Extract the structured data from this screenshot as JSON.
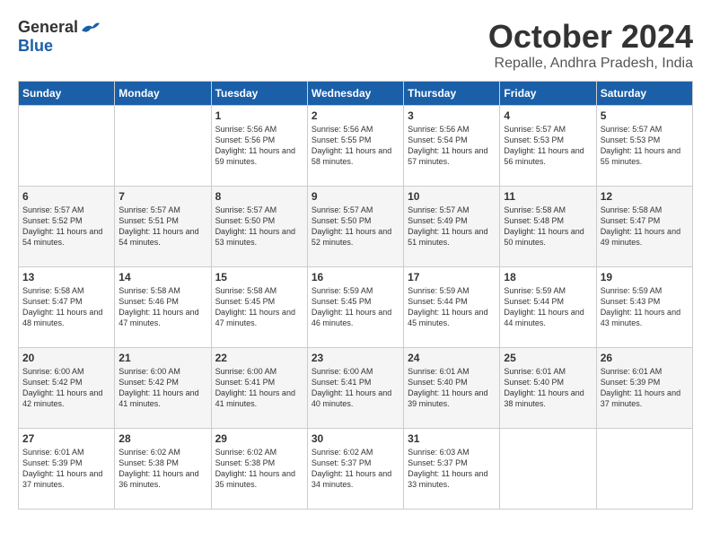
{
  "logo": {
    "general": "General",
    "blue": "Blue"
  },
  "title": "October 2024",
  "subtitle": "Repalle, Andhra Pradesh, India",
  "weekdays": [
    "Sunday",
    "Monday",
    "Tuesday",
    "Wednesday",
    "Thursday",
    "Friday",
    "Saturday"
  ],
  "weeks": [
    [
      {
        "day": "",
        "info": ""
      },
      {
        "day": "",
        "info": ""
      },
      {
        "day": "1",
        "info": "Sunrise: 5:56 AM\nSunset: 5:56 PM\nDaylight: 11 hours and 59 minutes."
      },
      {
        "day": "2",
        "info": "Sunrise: 5:56 AM\nSunset: 5:55 PM\nDaylight: 11 hours and 58 minutes."
      },
      {
        "day": "3",
        "info": "Sunrise: 5:56 AM\nSunset: 5:54 PM\nDaylight: 11 hours and 57 minutes."
      },
      {
        "day": "4",
        "info": "Sunrise: 5:57 AM\nSunset: 5:53 PM\nDaylight: 11 hours and 56 minutes."
      },
      {
        "day": "5",
        "info": "Sunrise: 5:57 AM\nSunset: 5:53 PM\nDaylight: 11 hours and 55 minutes."
      }
    ],
    [
      {
        "day": "6",
        "info": "Sunrise: 5:57 AM\nSunset: 5:52 PM\nDaylight: 11 hours and 54 minutes."
      },
      {
        "day": "7",
        "info": "Sunrise: 5:57 AM\nSunset: 5:51 PM\nDaylight: 11 hours and 54 minutes."
      },
      {
        "day": "8",
        "info": "Sunrise: 5:57 AM\nSunset: 5:50 PM\nDaylight: 11 hours and 53 minutes."
      },
      {
        "day": "9",
        "info": "Sunrise: 5:57 AM\nSunset: 5:50 PM\nDaylight: 11 hours and 52 minutes."
      },
      {
        "day": "10",
        "info": "Sunrise: 5:57 AM\nSunset: 5:49 PM\nDaylight: 11 hours and 51 minutes."
      },
      {
        "day": "11",
        "info": "Sunrise: 5:58 AM\nSunset: 5:48 PM\nDaylight: 11 hours and 50 minutes."
      },
      {
        "day": "12",
        "info": "Sunrise: 5:58 AM\nSunset: 5:47 PM\nDaylight: 11 hours and 49 minutes."
      }
    ],
    [
      {
        "day": "13",
        "info": "Sunrise: 5:58 AM\nSunset: 5:47 PM\nDaylight: 11 hours and 48 minutes."
      },
      {
        "day": "14",
        "info": "Sunrise: 5:58 AM\nSunset: 5:46 PM\nDaylight: 11 hours and 47 minutes."
      },
      {
        "day": "15",
        "info": "Sunrise: 5:58 AM\nSunset: 5:45 PM\nDaylight: 11 hours and 47 minutes."
      },
      {
        "day": "16",
        "info": "Sunrise: 5:59 AM\nSunset: 5:45 PM\nDaylight: 11 hours and 46 minutes."
      },
      {
        "day": "17",
        "info": "Sunrise: 5:59 AM\nSunset: 5:44 PM\nDaylight: 11 hours and 45 minutes."
      },
      {
        "day": "18",
        "info": "Sunrise: 5:59 AM\nSunset: 5:44 PM\nDaylight: 11 hours and 44 minutes."
      },
      {
        "day": "19",
        "info": "Sunrise: 5:59 AM\nSunset: 5:43 PM\nDaylight: 11 hours and 43 minutes."
      }
    ],
    [
      {
        "day": "20",
        "info": "Sunrise: 6:00 AM\nSunset: 5:42 PM\nDaylight: 11 hours and 42 minutes."
      },
      {
        "day": "21",
        "info": "Sunrise: 6:00 AM\nSunset: 5:42 PM\nDaylight: 11 hours and 41 minutes."
      },
      {
        "day": "22",
        "info": "Sunrise: 6:00 AM\nSunset: 5:41 PM\nDaylight: 11 hours and 41 minutes."
      },
      {
        "day": "23",
        "info": "Sunrise: 6:00 AM\nSunset: 5:41 PM\nDaylight: 11 hours and 40 minutes."
      },
      {
        "day": "24",
        "info": "Sunrise: 6:01 AM\nSunset: 5:40 PM\nDaylight: 11 hours and 39 minutes."
      },
      {
        "day": "25",
        "info": "Sunrise: 6:01 AM\nSunset: 5:40 PM\nDaylight: 11 hours and 38 minutes."
      },
      {
        "day": "26",
        "info": "Sunrise: 6:01 AM\nSunset: 5:39 PM\nDaylight: 11 hours and 37 minutes."
      }
    ],
    [
      {
        "day": "27",
        "info": "Sunrise: 6:01 AM\nSunset: 5:39 PM\nDaylight: 11 hours and 37 minutes."
      },
      {
        "day": "28",
        "info": "Sunrise: 6:02 AM\nSunset: 5:38 PM\nDaylight: 11 hours and 36 minutes."
      },
      {
        "day": "29",
        "info": "Sunrise: 6:02 AM\nSunset: 5:38 PM\nDaylight: 11 hours and 35 minutes."
      },
      {
        "day": "30",
        "info": "Sunrise: 6:02 AM\nSunset: 5:37 PM\nDaylight: 11 hours and 34 minutes."
      },
      {
        "day": "31",
        "info": "Sunrise: 6:03 AM\nSunset: 5:37 PM\nDaylight: 11 hours and 33 minutes."
      },
      {
        "day": "",
        "info": ""
      },
      {
        "day": "",
        "info": ""
      }
    ]
  ]
}
